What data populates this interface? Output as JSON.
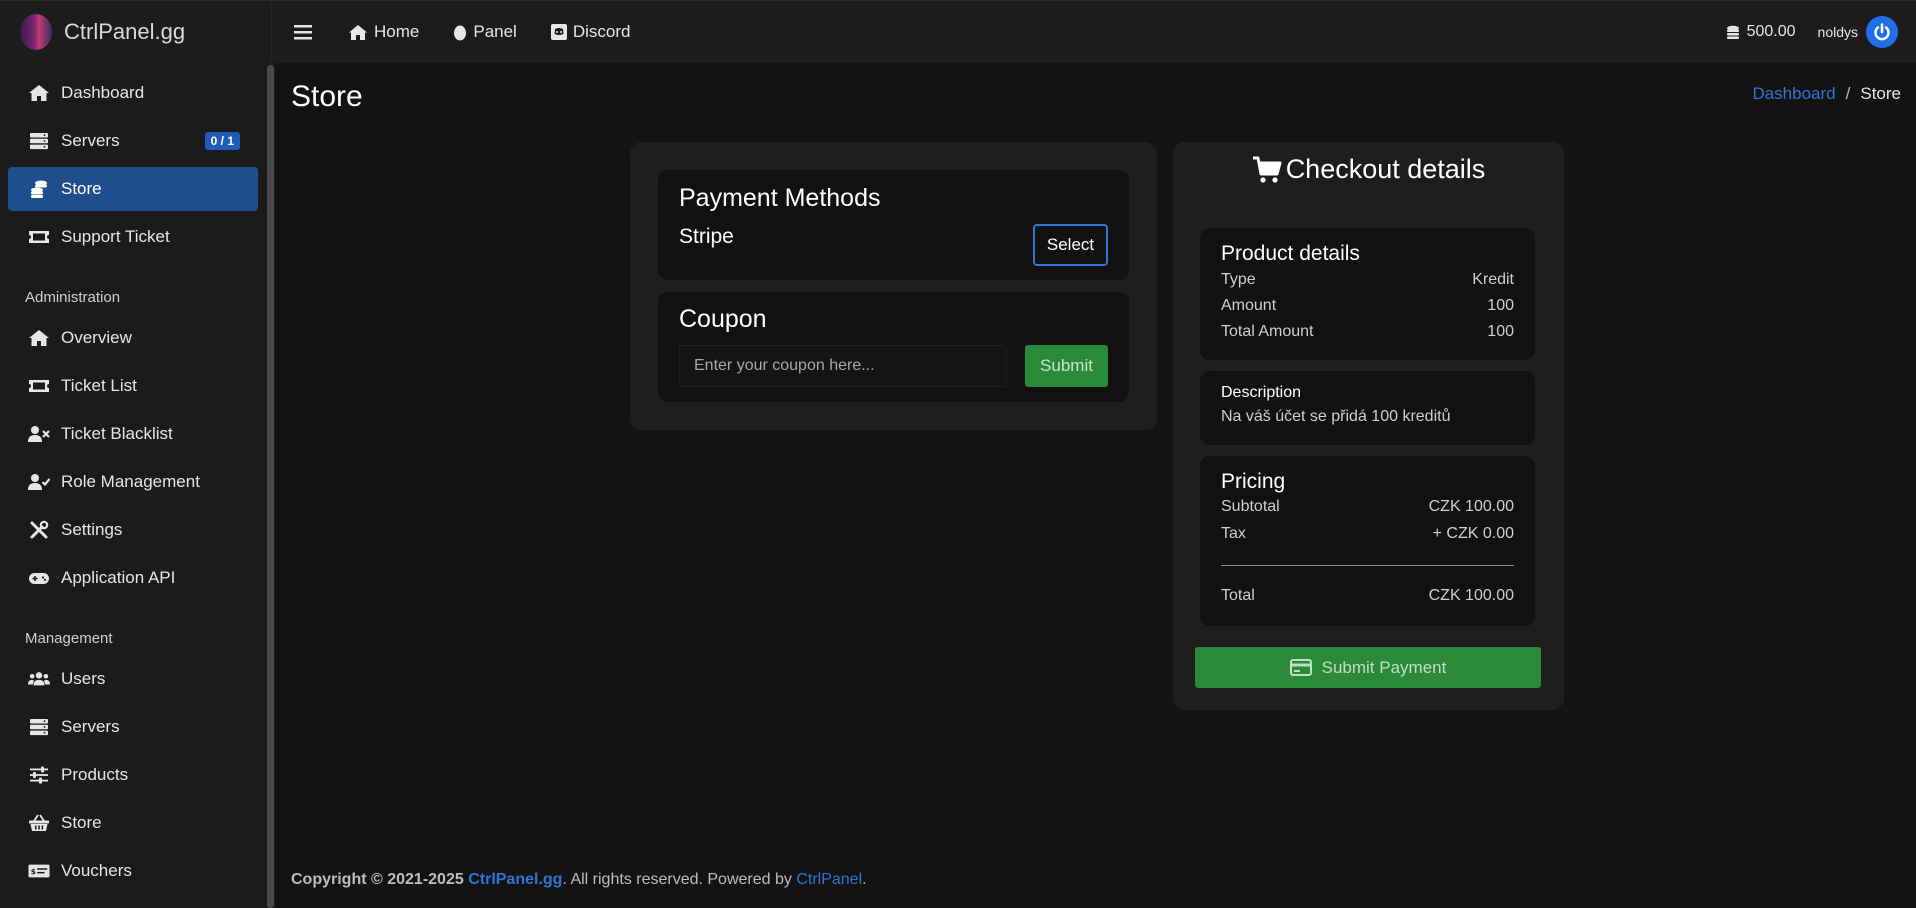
{
  "brand": {
    "name": "CtrlPanel.gg"
  },
  "topnav": {
    "items": [
      {
        "label": "Home",
        "icon": "home-icon"
      },
      {
        "label": "Panel",
        "icon": "egg-icon"
      },
      {
        "label": "Discord",
        "icon": "discord-icon"
      }
    ],
    "credits": "500.00",
    "username": "noldys"
  },
  "sidebar": {
    "items": [
      {
        "label": "Dashboard",
        "icon": "home-icon"
      },
      {
        "label": "Servers",
        "icon": "server-icon",
        "badge": "0 / 1"
      },
      {
        "label": "Store",
        "icon": "coins-icon",
        "active": true
      },
      {
        "label": "Support Ticket",
        "icon": "ticket-icon"
      }
    ],
    "admin_header": "Administration",
    "admin_items": [
      {
        "label": "Overview",
        "icon": "home-icon"
      },
      {
        "label": "Ticket List",
        "icon": "ticket-icon"
      },
      {
        "label": "Ticket Blacklist",
        "icon": "user-times-icon"
      },
      {
        "label": "Role Management",
        "icon": "user-check-icon"
      },
      {
        "label": "Settings",
        "icon": "tools-icon"
      },
      {
        "label": "Application API",
        "icon": "gamepad-icon"
      }
    ],
    "management_header": "Management",
    "management_items": [
      {
        "label": "Users",
        "icon": "users-icon"
      },
      {
        "label": "Servers",
        "icon": "server-icon"
      },
      {
        "label": "Products",
        "icon": "sliders-icon"
      },
      {
        "label": "Store",
        "icon": "basket-icon"
      },
      {
        "label": "Vouchers",
        "icon": "voucher-icon"
      }
    ]
  },
  "page": {
    "title": "Store",
    "breadcrumb": {
      "link": "Dashboard",
      "separator": "/",
      "current": "Store"
    }
  },
  "payment": {
    "title": "Payment Methods",
    "method": "Stripe",
    "select_label": "Select"
  },
  "coupon": {
    "title": "Coupon",
    "placeholder": "Enter your coupon here...",
    "submit_label": "Submit"
  },
  "checkout": {
    "title": "Checkout details",
    "product": {
      "title": "Product details",
      "rows": [
        {
          "label": "Type",
          "value": "Kredit"
        },
        {
          "label": "Amount",
          "value": "100"
        },
        {
          "label": "Total Amount",
          "value": "100"
        }
      ]
    },
    "description": {
      "title": "Description",
      "text": "Na váš účet se přidá 100 kreditů"
    },
    "pricing": {
      "title": "Pricing",
      "subtotal_label": "Subtotal",
      "subtotal_value": "CZK 100.00",
      "tax_label": "Tax",
      "tax_value": "+ CZK 0.00",
      "total_label": "Total",
      "total_value": "CZK 100.00"
    },
    "submit_label": "Submit Payment"
  },
  "footer": {
    "copyright": "Copyright © 2021-2025",
    "brand_link": "CtrlPanel.gg",
    "rights": ". All rights reserved. Powered by",
    "powered_link": "CtrlPanel",
    "end": "."
  },
  "colors": {
    "background": "#131313",
    "sidebar": "#1b1b1b",
    "active": "#1f4e8f",
    "link": "#2f74d6",
    "success": "#2a8a3a"
  }
}
